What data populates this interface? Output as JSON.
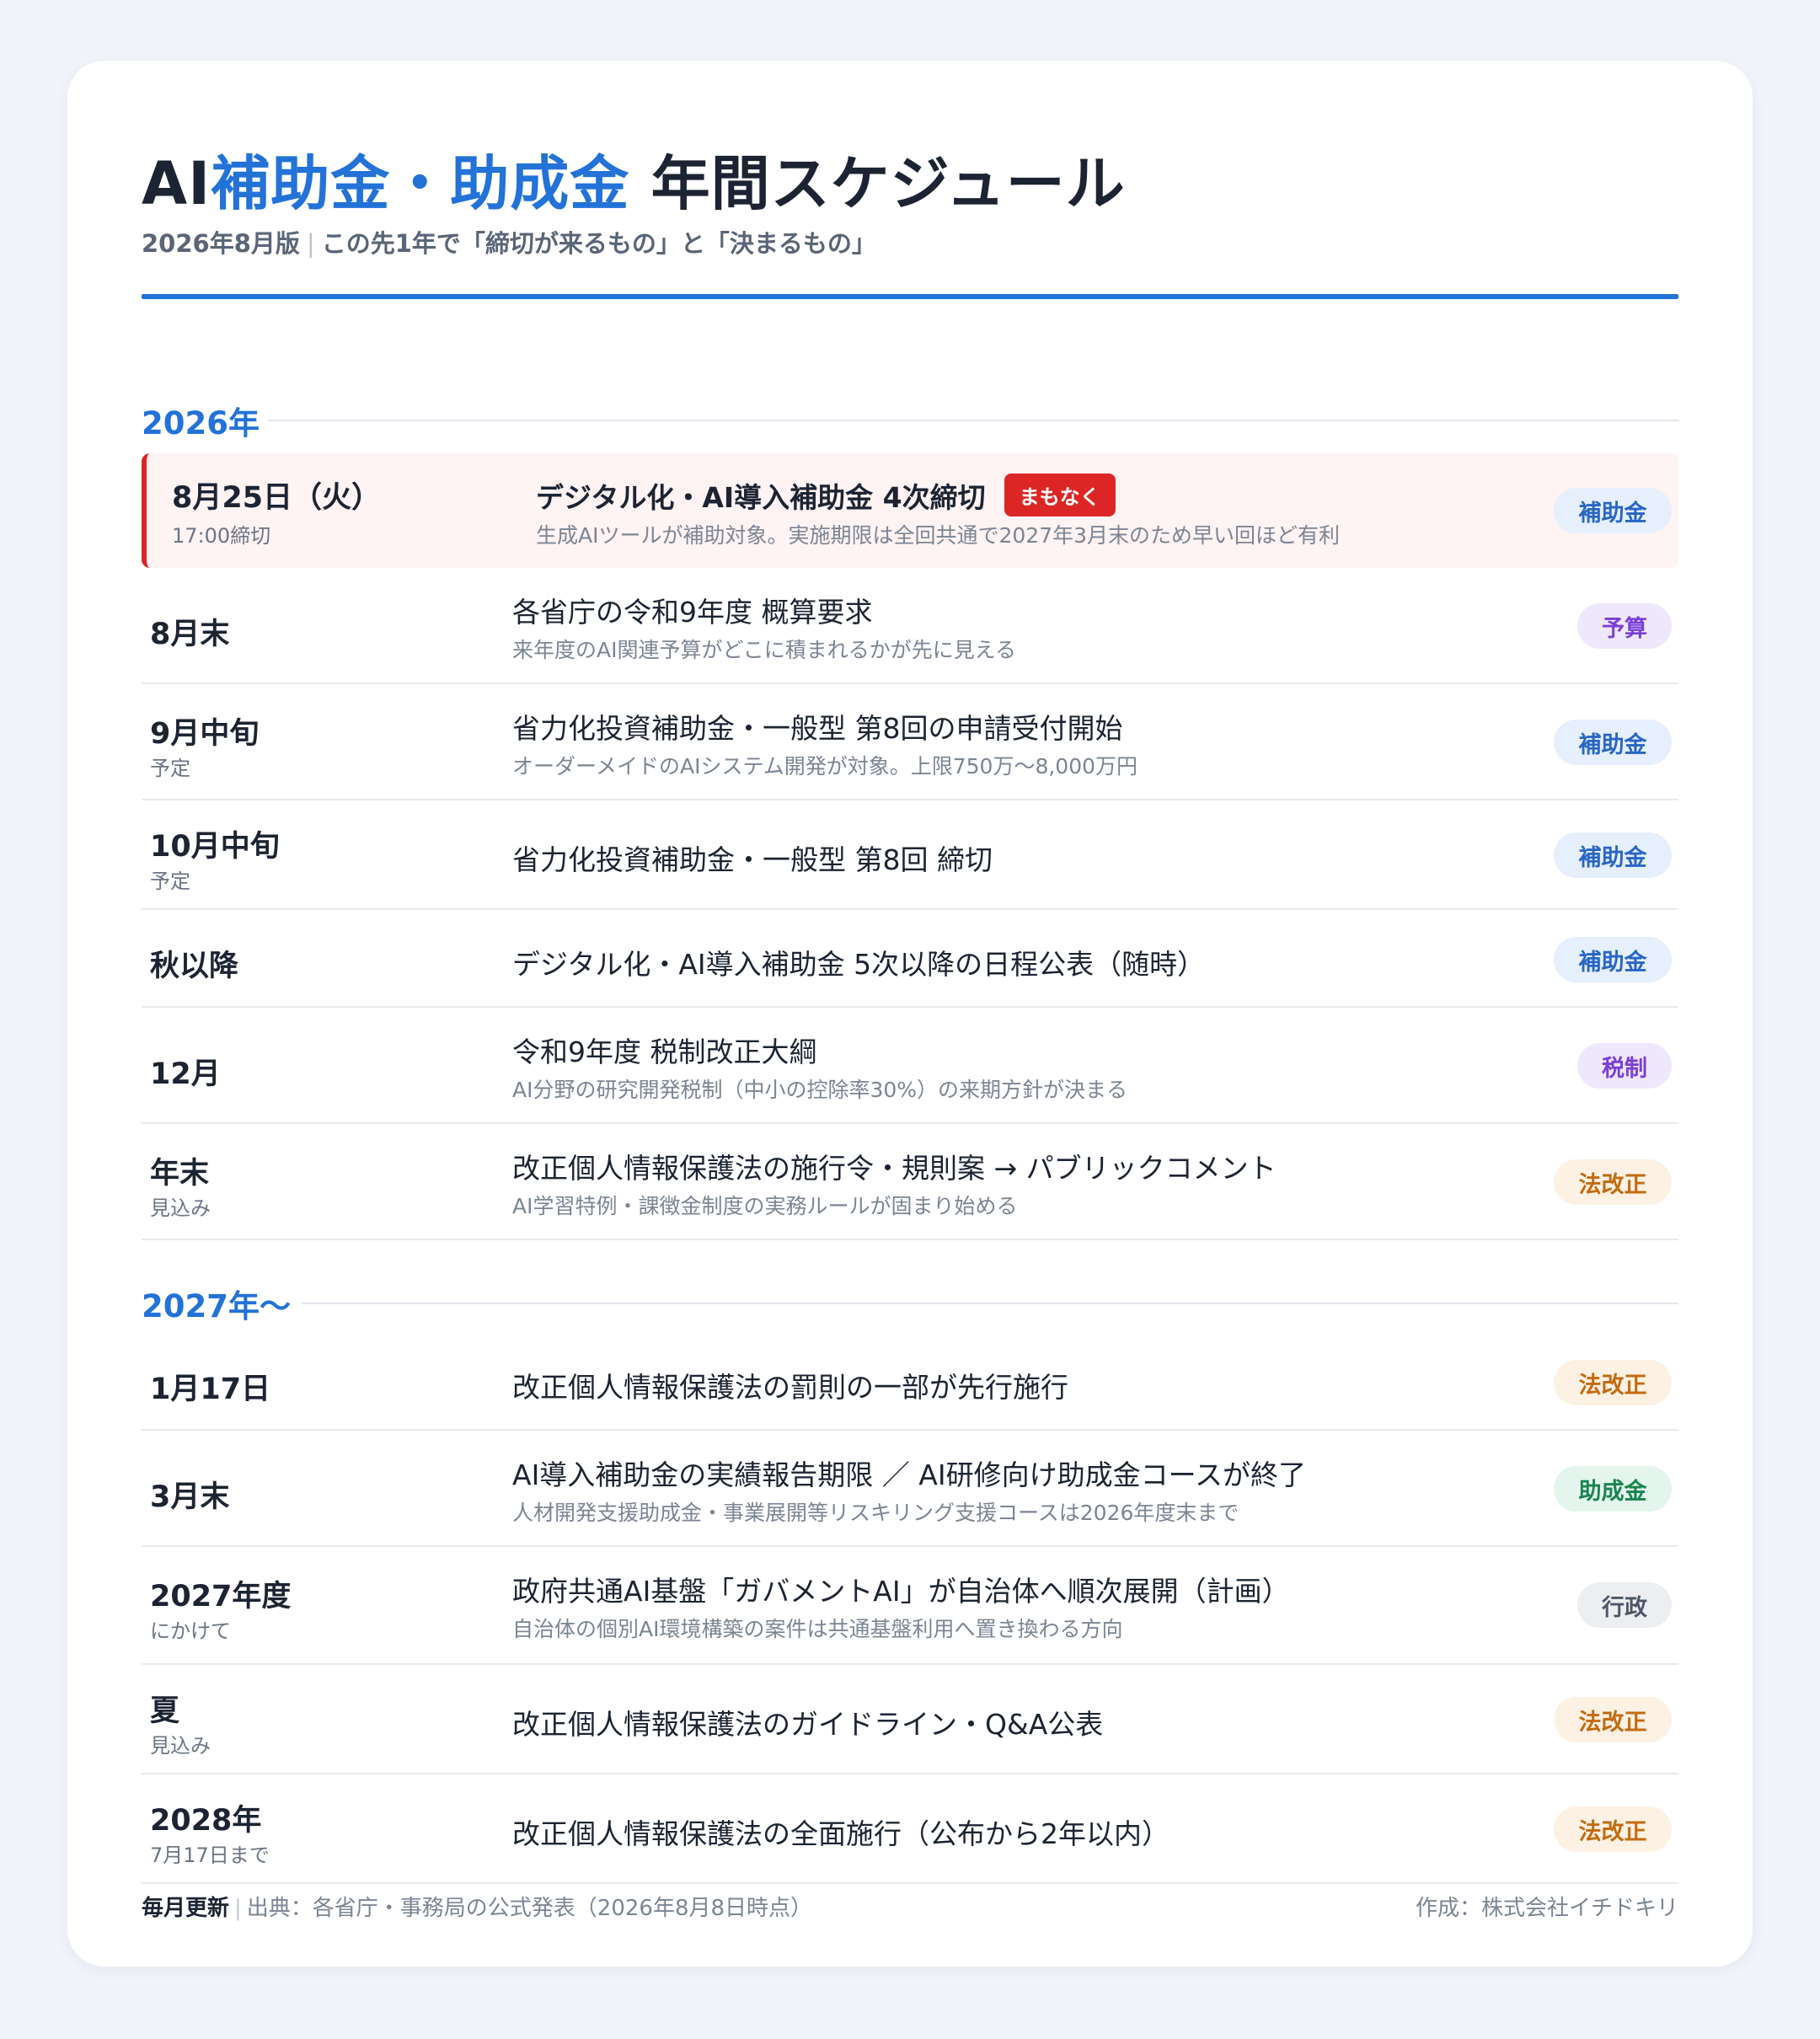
{
  "header": {
    "title_prefix": "AI",
    "title_accent": "補助金・助成金",
    "title_suffix": " 年間スケジュール",
    "edition": "2026年8月版",
    "tagline": "この先1年で「締切が来るもの」と「決まるもの」",
    "separator": "|"
  },
  "sections": [
    {
      "label": "2026年",
      "rows": [
        {
          "date": "8月25日（火）",
          "date_sub": "17:00締切",
          "event": "デジタル化・AI導入補助金 4次締切",
          "badge": "まもなく",
          "desc": "生成AIツールが補助対象。実施期限は全回共通で2027年3月末のため早い回ほど有利",
          "tag": "補助金"
        },
        {
          "date": "8月末",
          "event": "各省庁の令和9年度 概算要求",
          "desc": "来年度のAI関連予算がどこに積まれるかが先に見える",
          "tag": "予算"
        },
        {
          "date": "9月中旬",
          "date_sub": "予定",
          "event": "省力化投資補助金・一般型 第8回の申請受付開始",
          "desc": "オーダーメイドのAIシステム開発が対象。上限750万〜8,000万円",
          "tag": "補助金"
        },
        {
          "date": "10月中旬",
          "date_sub": "予定",
          "event": "省力化投資補助金・一般型 第8回 締切",
          "tag": "補助金"
        },
        {
          "date": "秋以降",
          "event": "デジタル化・AI導入補助金 5次以降の日程公表（随時）",
          "tag": "補助金"
        },
        {
          "date": "12月",
          "event": "令和9年度 税制改正大綱",
          "desc": "AI分野の研究開発税制（中小の控除率30%）の来期方針が決まる",
          "tag": "税制"
        },
        {
          "date": "年末",
          "date_sub": "見込み",
          "event": "改正個人情報保護法の施行令・規則案 → パブリックコメント",
          "desc": "AI学習特例・課徴金制度の実務ルールが固まり始める",
          "tag": "法改正"
        }
      ]
    },
    {
      "label": "2027年〜",
      "rows": [
        {
          "date": "1月17日",
          "event": "改正個人情報保護法の罰則の一部が先行施行",
          "tag": "法改正"
        },
        {
          "date": "3月末",
          "event": "AI導入補助金の実績報告期限 ／ AI研修向け助成金コースが終了",
          "desc": "人材開発支援助成金・事業展開等リスキリング支援コースは2026年度末まで",
          "tag": "助成金"
        },
        {
          "date": "2027年度",
          "date_sub": "にかけて",
          "event": "政府共通AI基盤「ガバメントAI」が自治体へ順次展開（計画）",
          "desc": "自治体の個別AI環境構築の案件は共通基盤利用へ置き換わる方向",
          "tag": "行政"
        },
        {
          "date": "夏",
          "date_sub": "見込み",
          "event": "改正個人情報保護法のガイドライン・Q&A公表",
          "tag": "法改正"
        },
        {
          "date": "2028年",
          "date_sub": "7月17日まで",
          "event": "改正個人情報保護法の全面施行（公布から2年以内）",
          "tag": "法改正"
        }
      ]
    }
  ],
  "footer": {
    "update_label": "毎月更新",
    "separator": "|",
    "source": "出典：各省庁・事務局の公式発表（2026年8月8日時点）",
    "author": "作成：株式会社イチドキリ"
  },
  "colors": {
    "accent": "#2272d8",
    "urgent": "#dc2626",
    "subsidy": "#2866c4",
    "budget_tax": "#7b3fd6",
    "law": "#c26b10",
    "grant": "#1a8450",
    "admin": "#4d5666"
  }
}
